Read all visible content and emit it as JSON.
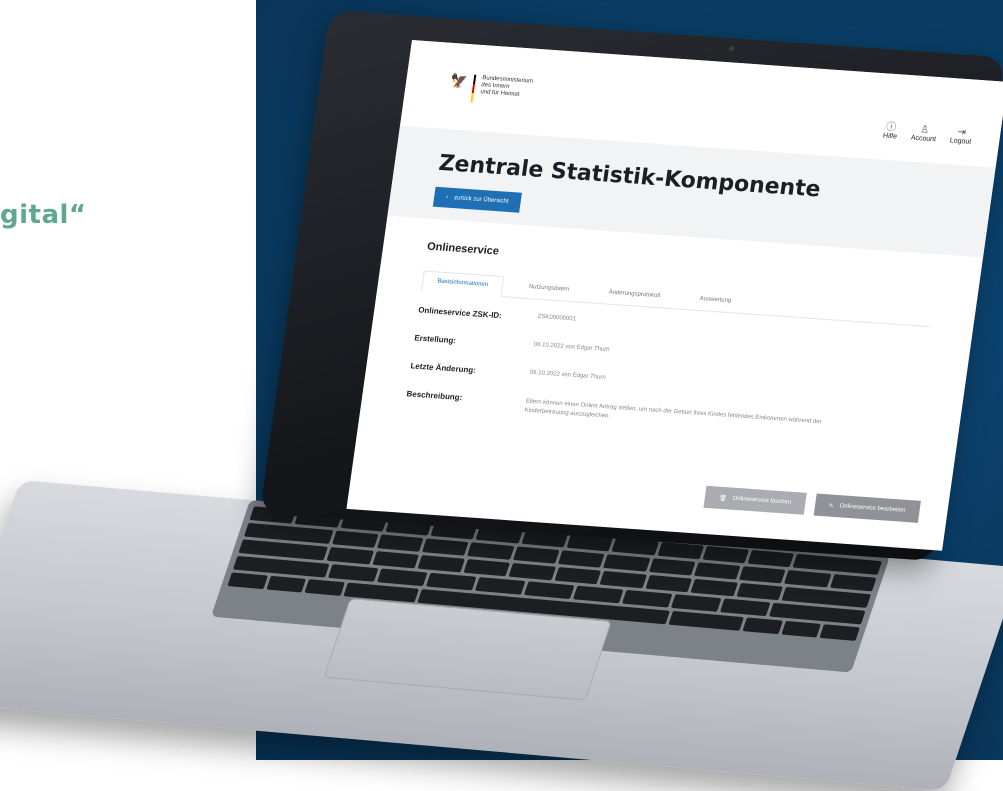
{
  "side_text": "gital“",
  "app": {
    "ministry_lines": [
      "Bundesministerium",
      "des Innern",
      "und für Heimat"
    ],
    "nav": [
      {
        "label": "Hilfe",
        "icon": "help-icon",
        "glyph": "ⓘ"
      },
      {
        "label": "Account",
        "icon": "user-icon",
        "glyph": "♙"
      },
      {
        "label": "Logout",
        "icon": "logout-icon",
        "glyph": "⇥"
      }
    ],
    "page_title": "Zentrale Statistik-Komponente",
    "back_label": "zurück zur Übersicht",
    "section_title": "Onlineservice",
    "tabs": [
      "Basisinformationen",
      "Nutzungsdaten",
      "Änderungsprotokoll",
      "Auswertung"
    ],
    "fields": [
      {
        "label": "Onlineservice ZSK-ID:",
        "value": "ZSK00000001"
      },
      {
        "label": "Erstellung:",
        "value": "06.10.2022 von Edgar Thurn"
      },
      {
        "label": "Letzte Änderung:",
        "value": "06.10.2022 von Edgar Thurn"
      },
      {
        "label": "Beschreibung:",
        "value": "Eltern können einen Online Antrag stellen, um nach der Geburt ihres Kindes fehlendes Einkommen während der Kinderbetreuung auszugleichen."
      }
    ],
    "actions": {
      "delete_label": "Onlineservice löschen",
      "edit_label": "Onlineservice bearbeiten"
    }
  },
  "colors": {
    "accent": "#1f6fb4",
    "background_panel": "#0a3d66",
    "side_text": "#5fa88f"
  }
}
